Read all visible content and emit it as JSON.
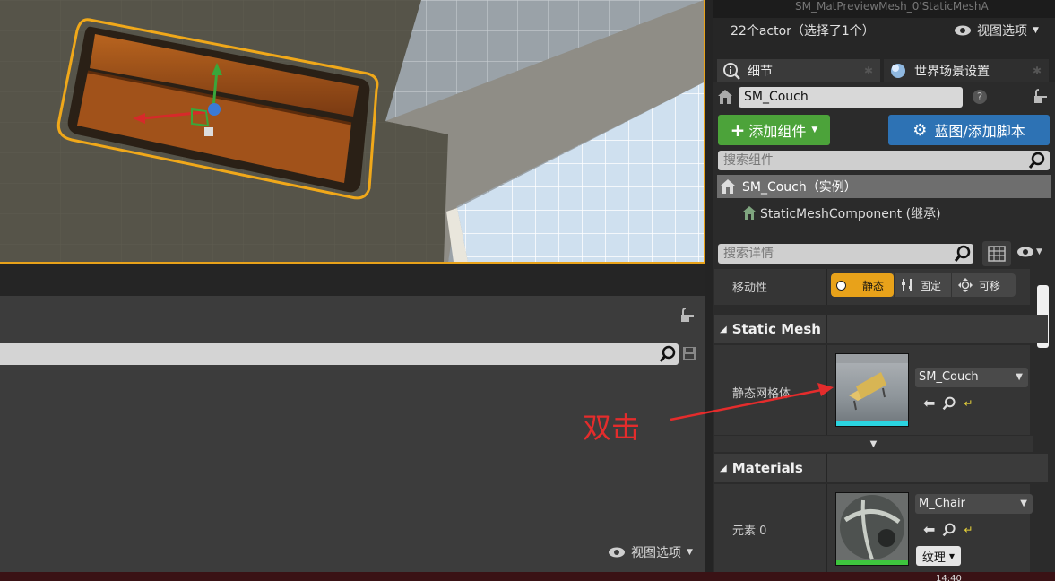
{
  "outliner": {
    "partial_row": "SM_MatPreviewMesh_0'StaticMeshA",
    "actor_count": "22个actor（选择了1个）",
    "view_options": "视图选项"
  },
  "tabs": [
    {
      "label": "细节",
      "icon": "info-icon"
    },
    {
      "label": "世界场景设置",
      "icon": "globe-icon"
    }
  ],
  "details": {
    "actor_name": "SM_Couch",
    "add_component_label": "添加组件",
    "blueprint_label": "蓝图/添加脚本",
    "search_components_placeholder": "搜索组件",
    "root_component": "SM_Couch（实例）",
    "child_component": "StaticMeshComponent (继承)",
    "search_details_placeholder": "搜索详情"
  },
  "mobility": {
    "label": "移动性",
    "options": [
      "静态",
      "固定",
      "可移"
    ],
    "selected": "静态"
  },
  "static_mesh": {
    "section_title": "Static Mesh",
    "prop_label": "静态网格体",
    "asset": "SM_Couch"
  },
  "materials": {
    "section_title": "Materials",
    "prop_label": "元素 0",
    "asset": "M_Chair",
    "texture_button": "纹理"
  },
  "left_panel": {
    "view_options": "视图选项"
  },
  "annotation": {
    "text": "双击",
    "color": "#e42c2c"
  },
  "taskbar": {
    "clock": "14:40"
  },
  "colors": {
    "selection_orange": "#e8a21a",
    "add_green": "#4ca33a",
    "blueprint_blue": "#2d72b4"
  }
}
